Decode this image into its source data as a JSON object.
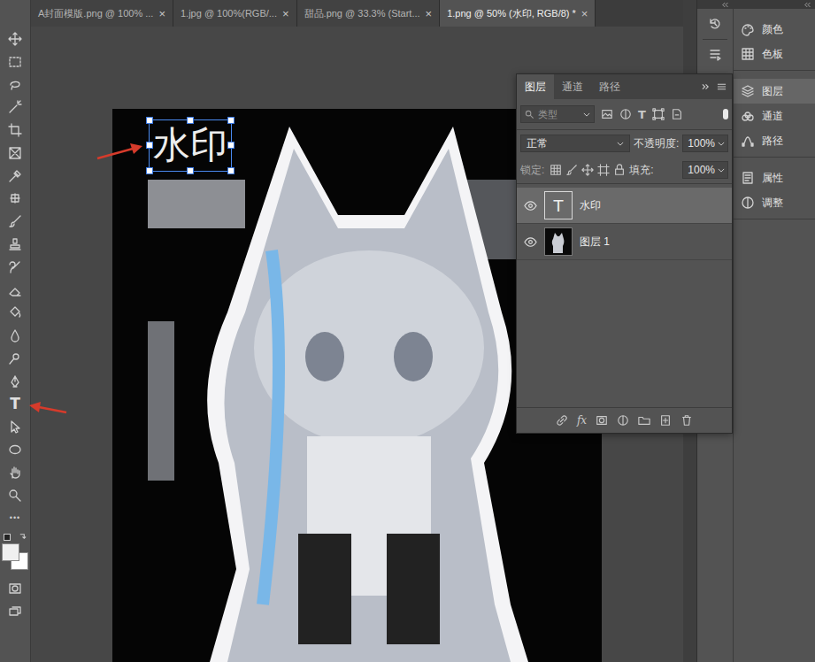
{
  "tabs": [
    {
      "label": "A封面模版.png @ 100% ...",
      "close": "×",
      "selected": false
    },
    {
      "label": "1.jpg @ 100%(RGB/...",
      "close": "×",
      "selected": false
    },
    {
      "label": "甜品.png @ 33.3% (Start...",
      "close": "×",
      "selected": false
    },
    {
      "label": "1.png @ 50% (水印, RGB/8) *",
      "close": "×",
      "selected": true
    }
  ],
  "toolbar": {
    "text_tool": "T",
    "more": "•••",
    "foreground": "#f0f0f0",
    "background": "#ffffff"
  },
  "canvas": {
    "watermark": "水印",
    "watermark_selected": true
  },
  "layers_panel": {
    "tabs": [
      {
        "label": "图层",
        "selected": true
      },
      {
        "label": "通道",
        "selected": false
      },
      {
        "label": "路径",
        "selected": false
      }
    ],
    "filter": {
      "label": "类型",
      "type_glyph": "T"
    },
    "blend_mode": "正常",
    "opacity_label": "不透明度:",
    "opacity": "100%",
    "lock_label": "锁定:",
    "fill_label": "填充:",
    "fill": "100%",
    "layers": [
      {
        "name": "水印",
        "kind": "text",
        "thumb": "T",
        "visible": true,
        "selected": true
      },
      {
        "name": "图层 1",
        "kind": "image",
        "thumb": "",
        "visible": true,
        "selected": false
      }
    ],
    "footer_fx": "fx"
  },
  "dock": {
    "groups": [
      [
        {
          "label": "颜色",
          "selected": false
        },
        {
          "label": "色板",
          "selected": false
        }
      ],
      [
        {
          "label": "图层",
          "selected": true
        },
        {
          "label": "通道",
          "selected": false
        },
        {
          "label": "路径",
          "selected": false
        }
      ],
      [
        {
          "label": "属性",
          "selected": false
        },
        {
          "label": "调整",
          "selected": false
        }
      ]
    ]
  }
}
